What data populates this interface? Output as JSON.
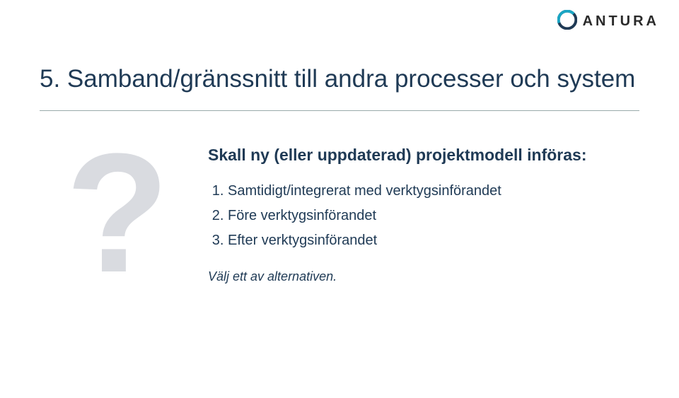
{
  "brand": {
    "name": "ANTURA",
    "logo_colors": {
      "outer": "#1f3a55",
      "inner": "#1aa6c4"
    }
  },
  "slide": {
    "title": "5. Samband/gränssnitt till andra processer och system",
    "question_mark": "?",
    "lead": "Skall ny (eller uppdaterad) projektmodell införas:",
    "options": [
      "Samtidigt/integrerat med verktygsinförandet",
      "Före verktygsinförandet",
      "Efter verktygsinförandet"
    ],
    "footnote": "Välj ett av alternativen."
  }
}
